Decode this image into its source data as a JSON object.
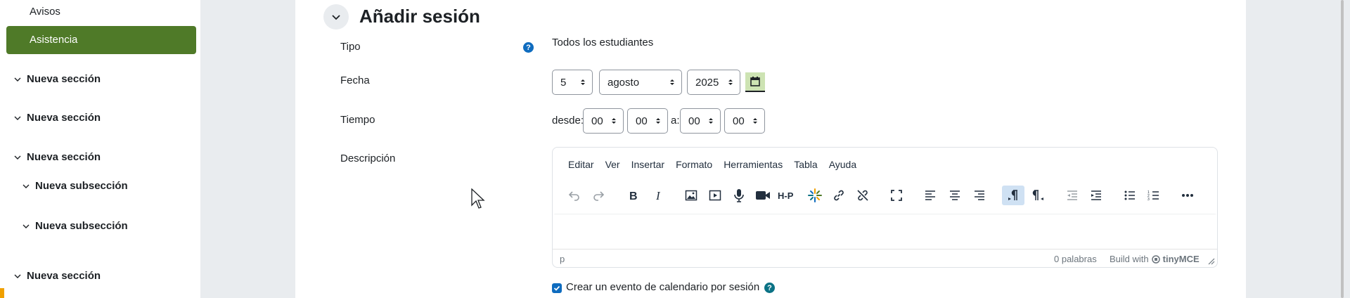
{
  "sidebar": {
    "avisos": "Avisos",
    "asistencia": "Asistencia",
    "sections": [
      {
        "label": "Nueva sección"
      },
      {
        "label": "Nueva sección"
      },
      {
        "label": "Nueva sección"
      },
      {
        "label": "Nueva subsección"
      },
      {
        "label": "Nueva subsección"
      },
      {
        "label": "Nueva sección"
      }
    ]
  },
  "form": {
    "title": "Añadir sesión",
    "tipo_label": "Tipo",
    "tipo_value": "Todos los estudiantes",
    "fecha_label": "Fecha",
    "fecha": {
      "day": "5",
      "month": "agosto",
      "year": "2025"
    },
    "tiempo_label": "Tiempo",
    "tiempo": {
      "desde": "desde:",
      "from_h": "00",
      "from_m": "00",
      "a": "a:",
      "to_h": "00",
      "to_m": "00"
    },
    "descripcion_label": "Descripción",
    "calendar_checkbox": "Crear un evento de calendario por sesión",
    "help": "?"
  },
  "editor": {
    "menu": [
      "Editar",
      "Ver",
      "Insertar",
      "Formato",
      "Herramientas",
      "Tabla",
      "Ayuda"
    ],
    "status_path": "p",
    "word_count": "0 palabras",
    "build_with": "Build with",
    "brand": "tinyMCE"
  },
  "colors": {
    "accent_green": "#4f7a28",
    "primary": "#0f6cbf"
  }
}
